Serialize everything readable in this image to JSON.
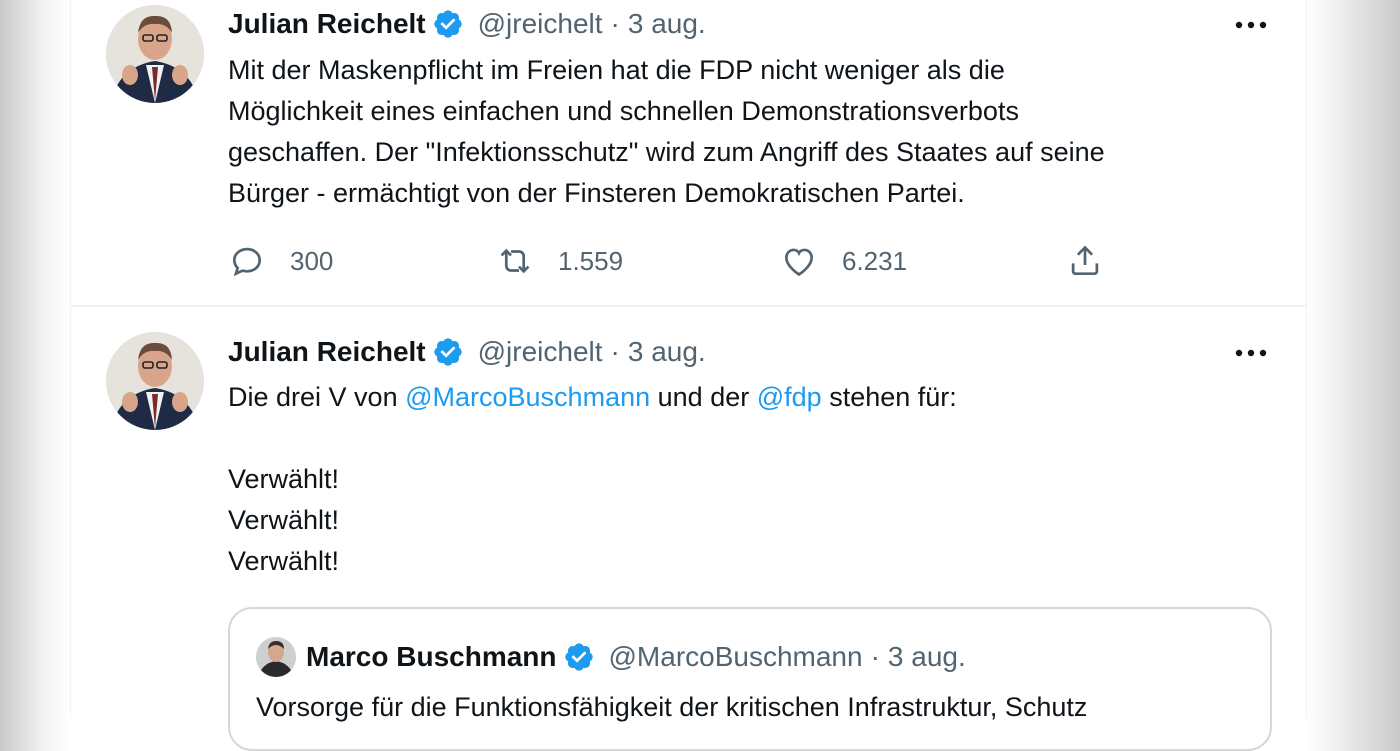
{
  "tweets": [
    {
      "author_name": "Julian Reichelt",
      "handle": "@jreichelt",
      "separator": "·",
      "date": "3 aug.",
      "text_lines": [
        "Mit der Maskenpflicht im Freien hat die FDP nicht weniger als die",
        "Möglichkeit eines einfachen und schnellen Demonstrationsverbots",
        "geschaffen. Der \"Infektionsschutz\" wird zum Angriff des Staates auf seine",
        "Bürger - ermächtigt von der Finsteren Demokratischen Partei."
      ],
      "replies": "300",
      "retweets": "1.559",
      "likes": "6.231"
    },
    {
      "author_name": "Julian Reichelt",
      "handle": "@jreichelt",
      "separator": "·",
      "date": "3 aug.",
      "line1_prefix": "Die drei V von",
      "mention1": "@MarcoBuschmann",
      "line1_middle": "und der",
      "mention2": "@fdp",
      "line1_suffix": "stehen für:",
      "lines": [
        "Verwählt!",
        "Verwählt!",
        "Verwählt!"
      ],
      "quoted": {
        "author_name": "Marco Buschmann",
        "handle": "@MarcoBuschmann",
        "separator": "·",
        "date": "3 aug.",
        "text": "Vorsorge für die Funktionsfähigkeit der kritischen Infrastruktur, Schutz"
      }
    }
  ],
  "icons": {
    "verified": "verified-badge-icon",
    "more": "more-horizontal-icon",
    "reply": "reply-icon",
    "retweet": "retweet-icon",
    "like": "heart-icon",
    "share": "share-icon"
  },
  "colors": {
    "link": "#1d9bf0",
    "secondary_text": "#536471",
    "verified": "#1d9bf0",
    "border": "#cfd9de"
  }
}
